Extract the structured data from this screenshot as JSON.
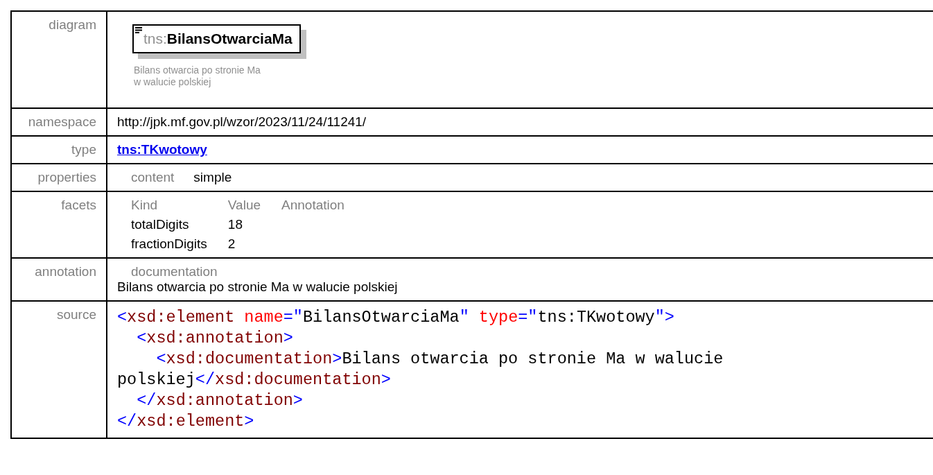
{
  "rows": [
    {
      "kind": "diagram",
      "label": "diagram",
      "element": {
        "prefix": "tns:",
        "name": "BilansOtwarciaMa"
      },
      "description": "Bilans otwarcia po stronie Ma\nw walucie polskiej"
    },
    {
      "kind": "text",
      "label": "namespace",
      "value": "http://jpk.mf.gov.pl/wzor/2023/11/24/11241/"
    },
    {
      "kind": "link",
      "label": "type",
      "value": "tns:TKwotowy"
    },
    {
      "kind": "pairs",
      "label": "properties",
      "pairs": [
        {
          "key": "content",
          "value": "simple"
        }
      ]
    },
    {
      "kind": "facets",
      "label": "facets",
      "columns": [
        "Kind",
        "Value",
        "Annotation"
      ],
      "facet_rows": [
        {
          "kind": "totalDigits",
          "value": "18"
        },
        {
          "kind": "fractionDigits",
          "value": "2"
        }
      ]
    },
    {
      "kind": "annotation",
      "label": "annotation",
      "heading": "documentation",
      "value": "Bilans otwarcia po stronie Ma w walucie polskiej"
    },
    {
      "kind": "source",
      "label": "source",
      "lines": [
        [
          {
            "kind": "punct",
            "text": "<"
          },
          {
            "kind": "tag",
            "text": "xsd:element"
          },
          {
            "kind": "attr",
            "text": " name"
          },
          {
            "kind": "punct",
            "text": "=\""
          },
          {
            "kind": "plain",
            "text": "BilansOtwarciaMa"
          },
          {
            "kind": "punct",
            "text": "\""
          },
          {
            "kind": "attr",
            "text": " type"
          },
          {
            "kind": "punct",
            "text": "=\""
          },
          {
            "kind": "plain",
            "text": "tns:TKwotowy"
          },
          {
            "kind": "punct",
            "text": "\">"
          }
        ],
        [
          {
            "kind": "punct",
            "text": "  <"
          },
          {
            "kind": "tag",
            "text": "xsd:annotation"
          },
          {
            "kind": "punct",
            "text": ">"
          }
        ],
        [
          {
            "kind": "punct",
            "text": "    <"
          },
          {
            "kind": "tag",
            "text": "xsd:documentation"
          },
          {
            "kind": "punct",
            "text": ">"
          },
          {
            "kind": "plain",
            "text": "Bilans otwarcia po stronie Ma w walucie"
          }
        ],
        [
          {
            "kind": "plain",
            "text": "polskiej"
          },
          {
            "kind": "punct",
            "text": "</"
          },
          {
            "kind": "tag",
            "text": "xsd:documentation"
          },
          {
            "kind": "punct",
            "text": ">"
          }
        ],
        [
          {
            "kind": "punct",
            "text": "  </"
          },
          {
            "kind": "tag",
            "text": "xsd:annotation"
          },
          {
            "kind": "punct",
            "text": ">"
          }
        ],
        [
          {
            "kind": "punct",
            "text": "</"
          },
          {
            "kind": "tag",
            "text": "xsd:element"
          },
          {
            "kind": "punct",
            "text": ">"
          }
        ]
      ]
    }
  ]
}
